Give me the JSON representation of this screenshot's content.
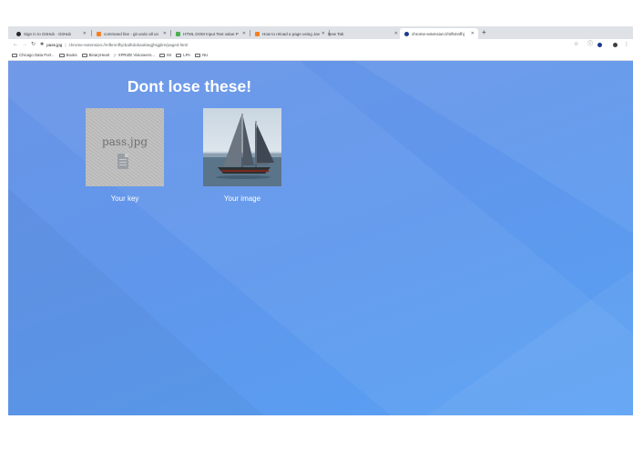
{
  "browser": {
    "tabs": [
      {
        "title": "Sign in to GitHub · GitHub",
        "favicon": "github-icon"
      },
      {
        "title": "command line - git undo all un",
        "favicon": "stackoverflow-icon"
      },
      {
        "title": "HTML DOM Input Text value P",
        "favicon": "w3schools-icon"
      },
      {
        "title": "How to reload a page using Jav",
        "favicon": "stackoverflow-icon"
      },
      {
        "title": "New Tab",
        "favicon": ""
      },
      {
        "title": "chrome-extension://mfkmnfhj",
        "favicon": "extension-icon",
        "active": true
      }
    ],
    "address": {
      "host": "pass.jpg",
      "path": "chrome-extension://mfkmnfhjcbalhdobaoktegjhsjglim/page3.html"
    },
    "bookmarks": [
      {
        "label": "Chicago Data Port...",
        "icon": "folder-icon"
      },
      {
        "label": "Books",
        "icon": "folder-icon"
      },
      {
        "label": "BinaryHeart",
        "icon": "folder-icon"
      },
      {
        "label": "XPRIZE Visioneers...",
        "icon": "xprize-icon"
      },
      {
        "label": "ISI",
        "icon": "folder-icon"
      },
      {
        "label": "LPA",
        "icon": "folder-icon"
      },
      {
        "label": "NU",
        "icon": "folder-icon"
      }
    ]
  },
  "page": {
    "heading": "Dont lose these!",
    "cards": [
      {
        "caption": "Your key",
        "image_text": "pass.jpg"
      },
      {
        "caption": "Your image"
      }
    ]
  },
  "colors": {
    "accent": "#5a9bef",
    "profile_dot": "#1a3a8f"
  }
}
